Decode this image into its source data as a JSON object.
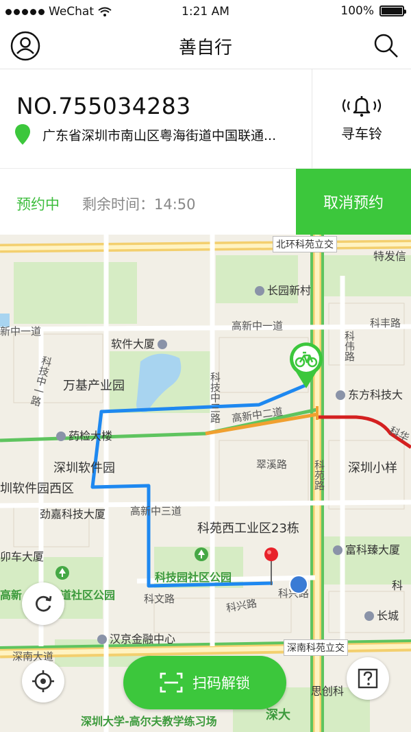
{
  "status_bar": {
    "carrier": "WeChat",
    "time": "1:21 AM",
    "battery": "100%"
  },
  "nav": {
    "title": "善自行",
    "left_icon": "user-icon",
    "right_icon": "search-icon"
  },
  "bike": {
    "code": "NO.755034283",
    "address": "广东省深圳市南山区粤海街道中国联通..."
  },
  "bell": {
    "label": "寻车铃",
    "icon": "bell-ring-icon"
  },
  "reservation": {
    "status": "预约中",
    "remaining": "剩余时间：14:50",
    "cancel_label": "取消预约"
  },
  "map": {
    "labels": {
      "beihuan": "北环科苑立交",
      "tefa": "特发信",
      "changyuan": "长园新村",
      "kefeng": "科丰路",
      "gaoxin1a": "高新中一道",
      "gaoxin1b": "新中一道",
      "ruanjian": "软件大厦",
      "kewei": "科伟路",
      "dongfang": "东方科技大",
      "kejizhong": "科技中一路",
      "wanji": "万基产业园",
      "kejizhong3": "科技中三路",
      "gaoxin2": "高新中二道",
      "yaojian": "药检大楼",
      "kehua": "科华",
      "cuixi": "翠溪路",
      "shenzhenxiaomei": "深圳小样",
      "ruanjianyuan": "深圳软件园",
      "ruanjianxiyuan": "圳软件园西区",
      "keyuan": "科苑路",
      "jinjia": "劲嘉科技大厦",
      "gaoxin3": "高新中三道",
      "keyuanxi": "科苑西工业区23栋",
      "fuke": "富科臻大厦",
      "chaoda": "卯车大厦",
      "kejiyuanpark": "科技园社区公园",
      "kewen": "科文路",
      "kexing1": "科兴路",
      "kexing2": "科兴路",
      "ke": "科",
      "gaoxinpark": "高新",
      "parkright": "道社区公园",
      "changcheng": "长城",
      "hanjing": "汉京金融中心",
      "shennan": "深南大道",
      "shennankeyuan": "深南科苑立交",
      "sichuang": "思创科",
      "szu": "深圳大学-高尔夫教学练习场",
      "shenda": "深大"
    }
  },
  "controls": {
    "refresh_icon": "refresh-icon",
    "locate_icon": "locate-icon",
    "help_icon": "help-icon",
    "scan_icon": "scan-icon"
  },
  "scan": {
    "label": "扫码解锁"
  },
  "colors": {
    "accent": "#3cc73c",
    "route": "#1e88f0",
    "pin": "#e8222a",
    "user_dot": "#3a7bd5"
  }
}
